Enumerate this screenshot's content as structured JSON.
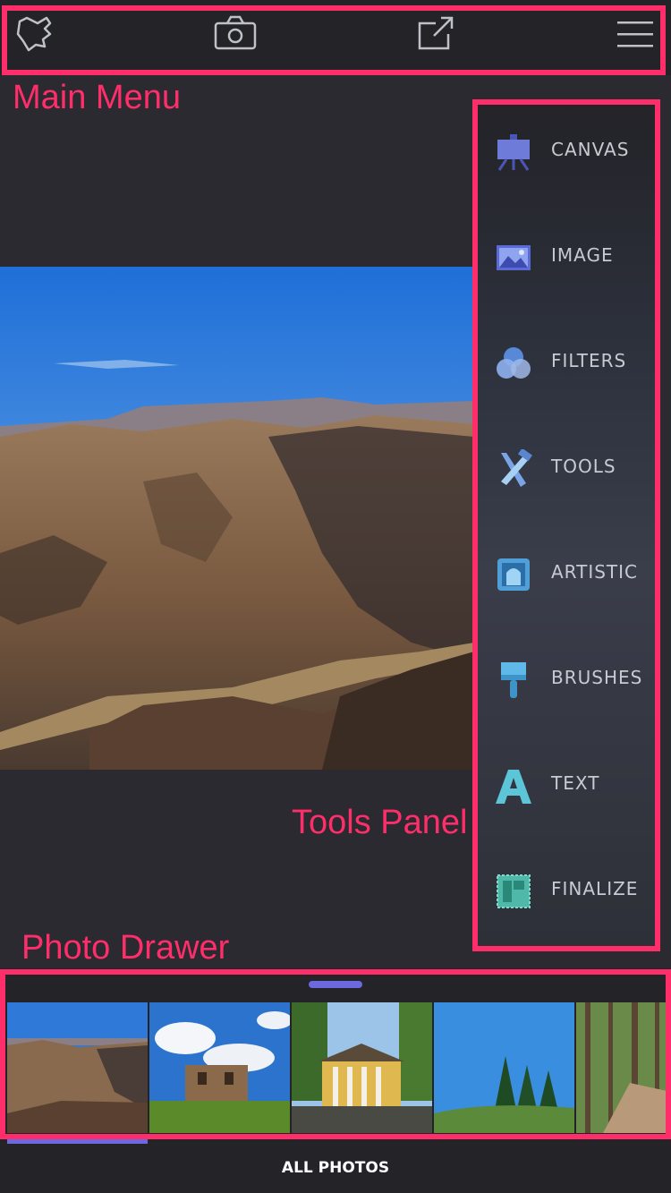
{
  "annotations": {
    "main_menu": "Main Menu",
    "tools_panel": "Tools Panel",
    "photo_drawer": "Photo Drawer"
  },
  "top_bar": {
    "icons": [
      "logo-icon",
      "camera-icon",
      "share-icon",
      "hamburger-menu-icon"
    ]
  },
  "tools_panel": {
    "items": [
      {
        "label": "CANVAS",
        "icon": "easel-icon"
      },
      {
        "label": "IMAGE",
        "icon": "image-icon"
      },
      {
        "label": "FILTERS",
        "icon": "filters-icon"
      },
      {
        "label": "TOOLS",
        "icon": "tools-icon"
      },
      {
        "label": "ARTISTIC",
        "icon": "artistic-icon"
      },
      {
        "label": "BRUSHES",
        "icon": "brush-icon"
      },
      {
        "label": "TEXT",
        "icon": "text-icon"
      },
      {
        "label": "FINALIZE",
        "icon": "finalize-icon"
      }
    ]
  },
  "photo_drawer": {
    "thumbnails": [
      "canyon",
      "ruins",
      "mansion",
      "hill-trees",
      "forest-path"
    ],
    "selected_index": 0
  },
  "bottom_bar": {
    "label": "ALL PHOTOS"
  },
  "colors": {
    "annotation": "#ff2e6a",
    "accent": "#6b68e0",
    "background": "#2a2a30"
  }
}
